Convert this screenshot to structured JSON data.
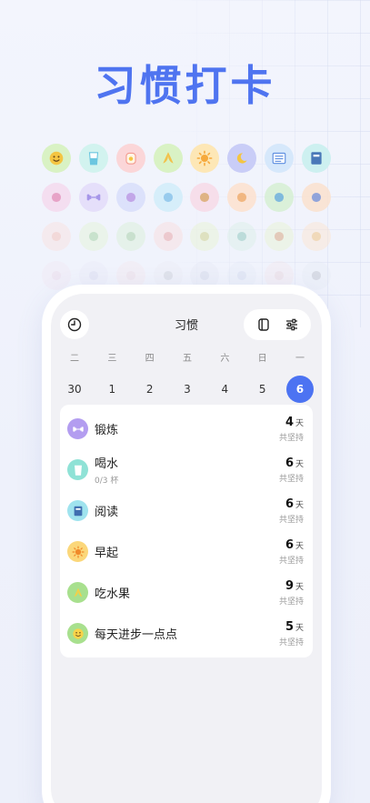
{
  "hero": {
    "title": "习惯打卡"
  },
  "icon_rows": [
    [
      {
        "icon": "smile-icon",
        "bg": "#d9f2c4",
        "fg": "#f4c542"
      },
      {
        "icon": "water-glass-icon",
        "bg": "#d2f3ef",
        "fg": "#6cc6e0"
      },
      {
        "icon": "toast-icon",
        "bg": "#fbd6d8",
        "fg": "#f39a8f"
      },
      {
        "icon": "banana-icon",
        "bg": "#d9f2c4",
        "fg": "#f2c14a"
      },
      {
        "icon": "sun-icon",
        "bg": "#fde7b6",
        "fg": "#f6a93b"
      },
      {
        "icon": "moon-sleep-icon",
        "bg": "#c9cdf7",
        "fg": "#f4c542"
      },
      {
        "icon": "word-card-icon",
        "bg": "#d6e8fb",
        "fg": "#5b8de0"
      },
      {
        "icon": "book-icon",
        "bg": "#cdf0f0",
        "fg": "#4a78b8"
      }
    ],
    [
      {
        "icon": "no-sugar-icon",
        "bg": "#f5dbef",
        "fg": "#e38ab5"
      },
      {
        "icon": "dumbbell-icon",
        "bg": "#e4dcfa",
        "fg": "#9a86e6"
      },
      {
        "icon": "lotus-icon",
        "bg": "#d9dffb",
        "fg": "#b48de0"
      },
      {
        "icon": "rainbow-icon",
        "bg": "#d2eefa",
        "fg": "#7dbde8"
      },
      {
        "icon": "no-fastfood-icon",
        "bg": "#f8dbe8",
        "fg": "#d8a05a"
      },
      {
        "icon": "broom-icon",
        "bg": "#fde2cf",
        "fg": "#f0a35a"
      },
      {
        "icon": "chat-icon",
        "bg": "#d6f0d4",
        "fg": "#5aa6d8"
      },
      {
        "icon": "pill-icon",
        "bg": "#fbe2cf",
        "fg": "#6b8ad6"
      }
    ],
    [
      {
        "icon": "face-mask-icon",
        "bg": "#fbe0df",
        "fg": "#f4b3a8"
      },
      {
        "icon": "eye-icon",
        "bg": "#e3f3d5",
        "fg": "#8cc78a"
      },
      {
        "icon": "tree-icon",
        "bg": "#d8f0d6",
        "fg": "#8fc48d"
      },
      {
        "icon": "search-icon",
        "bg": "#fbdcdc",
        "fg": "#e58c8c"
      },
      {
        "icon": "money-icon",
        "bg": "#e8f3d0",
        "fg": "#c3c46a"
      },
      {
        "icon": "scale-icon",
        "bg": "#d9efe7",
        "fg": "#6fb8a8"
      },
      {
        "icon": "no-smoking-icon",
        "bg": "#e8f3d0",
        "fg": "#d08a5a"
      },
      {
        "icon": "magic-wand-icon",
        "bg": "#fde4cf",
        "fg": "#f0b45a"
      }
    ],
    [
      {
        "icon": "no-drink-icon",
        "bg": "#f4d6e4",
        "fg": "#d9a0c0"
      },
      {
        "icon": "camera-icon",
        "bg": "#e2e0f4",
        "fg": "#a9a4d8"
      },
      {
        "icon": "music-icon",
        "bg": "#f8d9dc",
        "fg": "#e3a4ac"
      },
      {
        "icon": "clapper-icon",
        "bg": "#e4e4ea",
        "fg": "#7c7c8c"
      },
      {
        "icon": "film-icon",
        "bg": "#d8dced",
        "fg": "#8f97b8"
      },
      {
        "icon": "phone-icon",
        "bg": "#d9e3f4",
        "fg": "#8fa6d0"
      },
      {
        "icon": "game-icon",
        "bg": "#f8d8d8",
        "fg": "#df9a9a"
      },
      {
        "icon": "photo-icon",
        "bg": "#dde4ec",
        "fg": "#444b5a"
      }
    ]
  ],
  "screen": {
    "title": "习惯",
    "history_icon": "clock-icon",
    "view_icon": "card-view-icon",
    "settings_icon": "sliders-icon"
  },
  "week": {
    "days": [
      {
        "name": "二",
        "date": "30",
        "active": false
      },
      {
        "name": "三",
        "date": "1",
        "active": false
      },
      {
        "name": "四",
        "date": "2",
        "active": false
      },
      {
        "name": "五",
        "date": "3",
        "active": false
      },
      {
        "name": "六",
        "date": "4",
        "active": false
      },
      {
        "name": "日",
        "date": "5",
        "active": false
      },
      {
        "name": "一",
        "date": "6",
        "active": true
      }
    ]
  },
  "habits": [
    {
      "name": "锻炼",
      "sub": "",
      "count": "4",
      "unit": "天",
      "caption": "共坚持",
      "icon": "dumbbell-icon",
      "bg": "#b39df0",
      "fg": "#ffffff"
    },
    {
      "name": "喝水",
      "sub": "0/3 杯",
      "count": "6",
      "unit": "天",
      "caption": "共坚持",
      "icon": "water-glass-icon",
      "bg": "#8fe2d6",
      "fg": "#ffffff"
    },
    {
      "name": "阅读",
      "sub": "",
      "count": "6",
      "unit": "天",
      "caption": "共坚持",
      "icon": "book-icon",
      "bg": "#9fe3ee",
      "fg": "#3f6fb0"
    },
    {
      "name": "早起",
      "sub": "",
      "count": "6",
      "unit": "天",
      "caption": "共坚持",
      "icon": "sun-icon",
      "bg": "#fbd77a",
      "fg": "#f08a2a"
    },
    {
      "name": "吃水果",
      "sub": "",
      "count": "9",
      "unit": "天",
      "caption": "共坚持",
      "icon": "banana-icon",
      "bg": "#a8e08e",
      "fg": "#f6cf45"
    },
    {
      "name": "每天进步一点点",
      "sub": "",
      "count": "5",
      "unit": "天",
      "caption": "共坚持",
      "icon": "smile-icon",
      "bg": "#a8e08e",
      "fg": "#f8d34a"
    }
  ]
}
